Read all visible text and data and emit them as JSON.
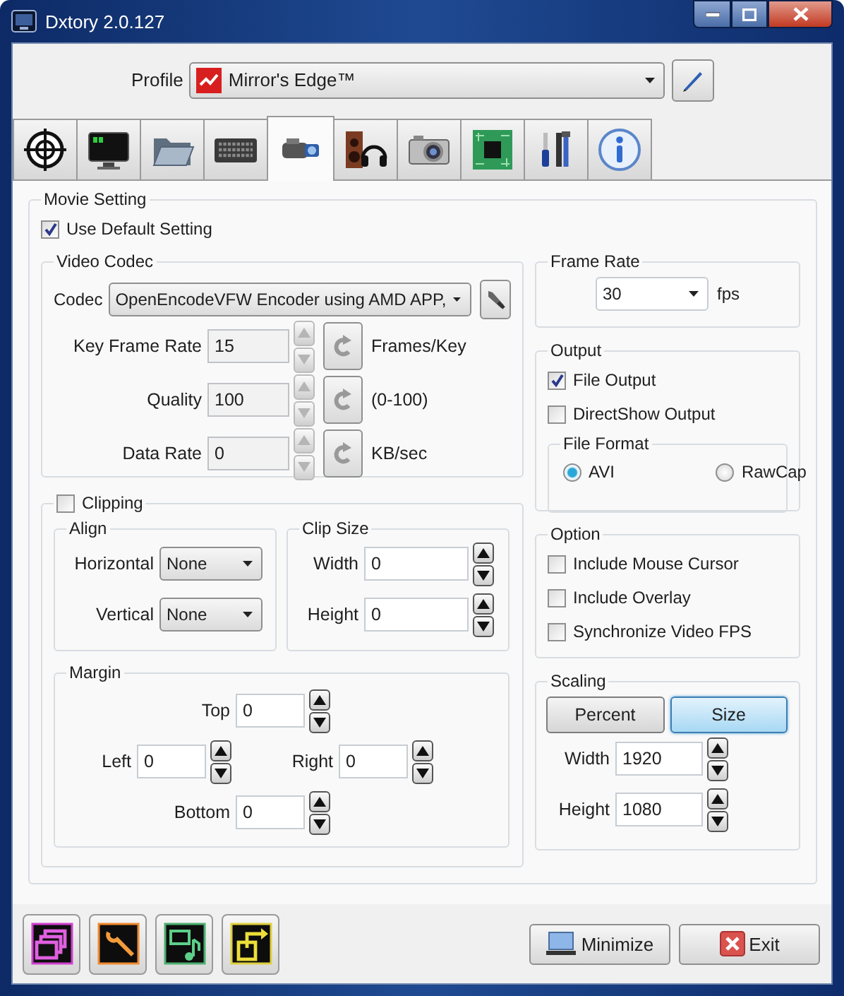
{
  "window": {
    "title": "Dxtory 2.0.127"
  },
  "profile": {
    "label": "Profile",
    "value": "Mirror's Edge™"
  },
  "tabs": [
    {
      "selected": false
    },
    {
      "selected": false
    },
    {
      "selected": false
    },
    {
      "selected": false
    },
    {
      "selected": true
    },
    {
      "selected": false
    },
    {
      "selected": false
    },
    {
      "selected": false
    },
    {
      "selected": false
    },
    {
      "selected": false
    }
  ],
  "movie_setting": {
    "title": "Movie Setting",
    "use_default": {
      "label": "Use Default Setting",
      "checked": true
    },
    "video_codec": {
      "title": "Video Codec",
      "codec_label": "Codec",
      "codec_value": "OpenEncodeVFW Encoder using AMD APP,",
      "params": [
        {
          "label": "Key Frame Rate",
          "value": "15",
          "unit": "Frames/Key",
          "disabled": true
        },
        {
          "label": "Quality",
          "value": "100",
          "unit": "(0-100)",
          "disabled": true
        },
        {
          "label": "Data Rate",
          "value": "0",
          "unit": "KB/sec",
          "disabled": true
        }
      ]
    },
    "clipping": {
      "label": "Clipping",
      "checked": false,
      "align": {
        "title": "Align",
        "rows": [
          {
            "label": "Horizontal",
            "value": "None"
          },
          {
            "label": "Vertical",
            "value": "None"
          }
        ]
      },
      "clip_size": {
        "title": "Clip Size",
        "rows": [
          {
            "label": "Width",
            "value": "0"
          },
          {
            "label": "Height",
            "value": "0"
          }
        ]
      },
      "margin": {
        "title": "Margin",
        "top": {
          "label": "Top",
          "value": "0"
        },
        "left": {
          "label": "Left",
          "value": "0"
        },
        "right": {
          "label": "Right",
          "value": "0"
        },
        "bottom": {
          "label": "Bottom",
          "value": "0"
        }
      }
    },
    "frame_rate": {
      "title": "Frame Rate",
      "value": "30",
      "unit": "fps"
    },
    "output": {
      "title": "Output",
      "options": [
        {
          "label": "File Output",
          "checked": true
        },
        {
          "label": "DirectShow Output",
          "checked": false
        }
      ],
      "file_format": {
        "title": "File Format",
        "options": [
          {
            "label": "AVI",
            "selected": true
          },
          {
            "label": "RawCap",
            "selected": false
          }
        ]
      }
    },
    "option": {
      "title": "Option",
      "options": [
        {
          "label": "Include Mouse Cursor",
          "checked": false
        },
        {
          "label": "Include Overlay",
          "checked": false
        },
        {
          "label": "Synchronize Video FPS",
          "checked": false
        }
      ]
    },
    "scaling": {
      "title": "Scaling",
      "modes": [
        {
          "label": "Percent",
          "selected": false
        },
        {
          "label": "Size",
          "selected": true
        }
      ],
      "rows": [
        {
          "label": "Width",
          "value": "1920"
        },
        {
          "label": "Height",
          "value": "1080"
        }
      ]
    }
  },
  "buttons": [
    {
      "kind": "minimize",
      "label": "Minimize"
    },
    {
      "kind": "exit",
      "label": "Exit"
    }
  ]
}
